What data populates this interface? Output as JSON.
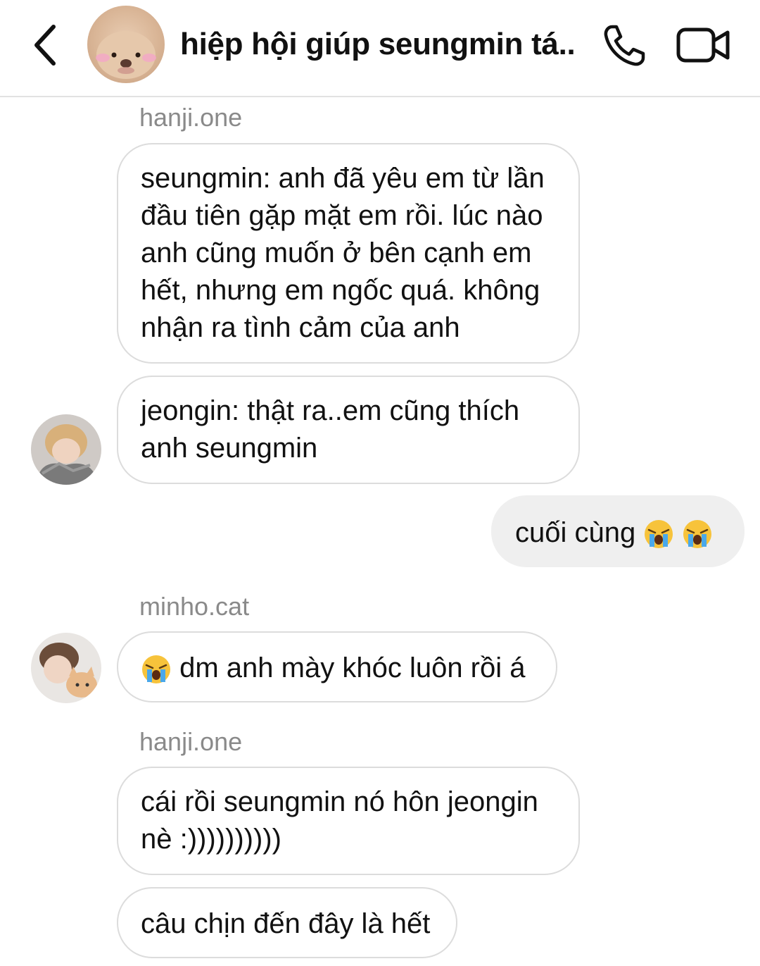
{
  "header": {
    "title": "hiệp hội giúp seungmin tá..",
    "icons": [
      "back-chevron-icon",
      "phone-icon",
      "video-camera-icon"
    ]
  },
  "messages": {
    "m1_sender": "hanji.one",
    "m1_text": "seungmin: anh đã yêu em từ lần đầu tiên gặp mặt em rồi. lúc nào anh cũng muốn ở bên cạnh em hết, nhưng em ngốc quá. không nhận ra tình cảm của anh",
    "m2_text": "jeongin: thật ra..em cũng thích anh seungmin",
    "m3_text": "cuối cùng",
    "m4_sender": "minho.cat",
    "m4_text": "dm anh mày khóc luôn rồi á",
    "m5_sender": "hanji.one",
    "m5_text": "cái rồi seungmin nó hôn jeongin nè :))))))))))",
    "m6_text": "câu chịn đến đây là hết"
  },
  "colors": {
    "sender_gray": "#8a8a8a",
    "bubble_border": "#dcdcdc",
    "own_bubble": "#efefef",
    "divider": "#e2e2e2"
  }
}
